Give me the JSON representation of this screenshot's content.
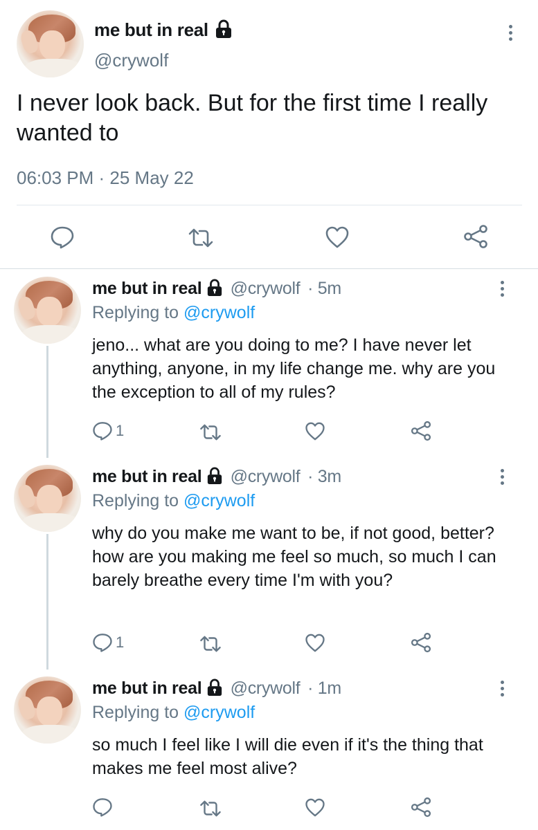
{
  "colors": {
    "text": "#14171a",
    "secondary": "#657786",
    "link": "#1d9bf0",
    "divider": "#e1e8ed"
  },
  "main_tweet": {
    "display_name": "me but in real",
    "handle": "@crywolf",
    "text": "I never look back. But for the first time I really wanted to",
    "timestamp": "06:03 PM · 25 May 22",
    "actions": [
      "reply-icon",
      "retweet-icon",
      "like-icon",
      "share-icon"
    ]
  },
  "replies": [
    {
      "display_name": "me but in real",
      "handle": "@crywolf",
      "age": "· 5m",
      "replying_prefix": "Replying to",
      "replying_to": "@crywolf",
      "text": "jeno... what are you doing to me? I have never let anything, anyone, in my life change me. why are you the exception to all of my rules?",
      "reply_count": "1"
    },
    {
      "display_name": "me but in real",
      "handle": "@crywolf",
      "age": "· 3m",
      "replying_prefix": "Replying to",
      "replying_to": "@crywolf",
      "text": "why do you make me want to be, if not good, better? how are you making me feel so much, so much I can barely breathe every time I'm with you?",
      "reply_count": "1"
    },
    {
      "display_name": "me but in real",
      "handle": "@crywolf",
      "age": "· 1m",
      "replying_prefix": "Replying to",
      "replying_to": "@crywolf",
      "text": "so much I feel like I will die even if it's the thing that makes me feel most alive?",
      "reply_count": ""
    }
  ]
}
